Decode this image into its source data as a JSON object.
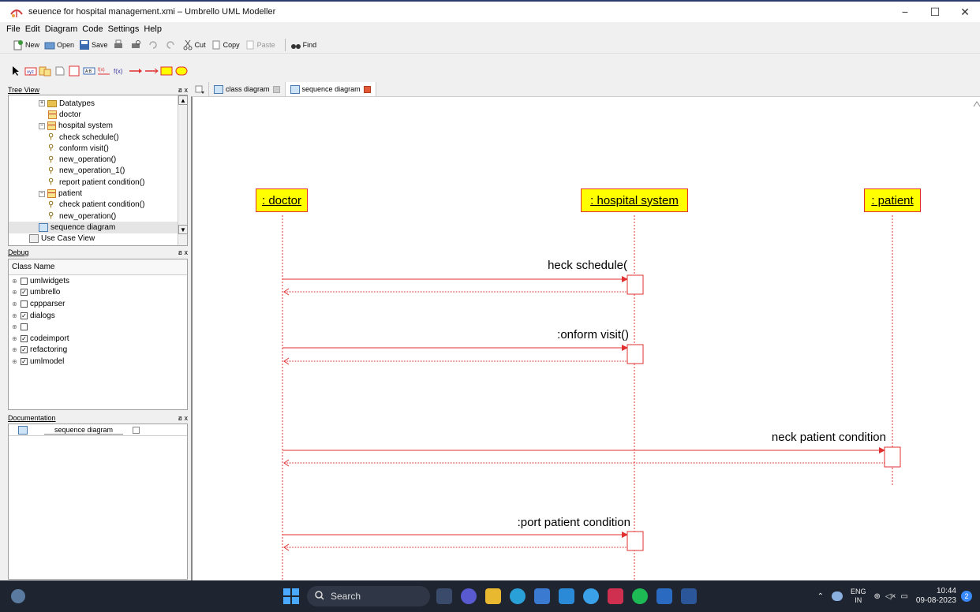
{
  "window": {
    "title": "seuence for hospital management.xmi – Umbrello UML Modeller",
    "controls": {
      "minimize": "−",
      "maximize": "☐",
      "close": "✕"
    }
  },
  "menu": [
    "File",
    "Edit",
    "Diagram",
    "Code",
    "Settings",
    "Help"
  ],
  "toolbar": {
    "new": "New",
    "open": "Open",
    "save": "Save",
    "cut": "Cut",
    "copy": "Copy",
    "paste": "Paste",
    "find": "Find"
  },
  "tree_view": {
    "title": "Tree View",
    "controls": "ฮ x",
    "items": [
      {
        "label": "Datatypes",
        "type": "folder",
        "indent": 1,
        "expander": "+"
      },
      {
        "label": "doctor",
        "type": "class",
        "indent": 2
      },
      {
        "label": "hospital system",
        "type": "class",
        "indent": 1,
        "expander": "−"
      },
      {
        "label": "check schedule()",
        "type": "op",
        "indent": 2
      },
      {
        "label": "conform visit()",
        "type": "op",
        "indent": 2
      },
      {
        "label": "new_operation()",
        "type": "op",
        "indent": 2
      },
      {
        "label": "new_operation_1()",
        "type": "op",
        "indent": 2
      },
      {
        "label": "report patient condition()",
        "type": "op",
        "indent": 2
      },
      {
        "label": "patient",
        "type": "class",
        "indent": 1,
        "expander": "−"
      },
      {
        "label": "check patient condition()",
        "type": "op",
        "indent": 2
      },
      {
        "label": "new_operation()",
        "type": "op",
        "indent": 2
      },
      {
        "label": "sequence diagram",
        "type": "diagram",
        "indent": 1,
        "selected": true
      },
      {
        "label": "Use Case View",
        "type": "doc",
        "indent": 0
      }
    ]
  },
  "debug": {
    "title": "Debug",
    "controls": "ฮ x",
    "column": "Class Name",
    "rows": [
      {
        "label": "umlwidgets",
        "checked": false
      },
      {
        "label": "umbrello",
        "checked": true
      },
      {
        "label": "cppparser",
        "checked": false
      },
      {
        "label": "dialogs",
        "checked": true
      },
      {
        "label": "",
        "checked": false
      },
      {
        "label": "codeimport",
        "checked": true
      },
      {
        "label": "refactoring",
        "checked": true
      },
      {
        "label": "umlmodel",
        "checked": true
      }
    ]
  },
  "documentation": {
    "title": "Documentation",
    "controls": "ฮ x",
    "item": "sequence diagram"
  },
  "tabs": [
    {
      "label": "class diagram",
      "active": false
    },
    {
      "label": "sequence diagram",
      "active": true
    }
  ],
  "diagram": {
    "objects": [
      {
        "label": ": doctor"
      },
      {
        "label": ": hospital system"
      },
      {
        "label": ": patient"
      }
    ],
    "messages": [
      {
        "label": "heck schedule("
      },
      {
        "label": ":onform visit()"
      },
      {
        "label": "neck patient condition"
      },
      {
        "label": ":port patient condition"
      }
    ]
  },
  "taskbar": {
    "search_placeholder": "Search",
    "lang_top": "ENG",
    "lang_bottom": "IN",
    "time": "10:44",
    "date": "09-08-2023",
    "notifications": "2"
  },
  "colors": {
    "object_fill": "#ffff00",
    "line_red": "#e03030",
    "taskbar": "#1f2530"
  }
}
